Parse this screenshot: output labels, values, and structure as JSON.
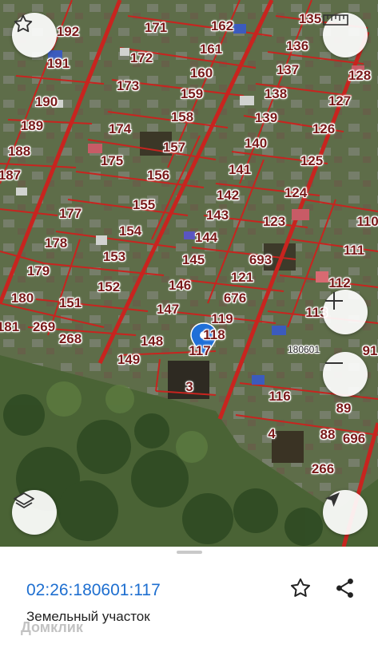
{
  "map": {
    "parcel_labels": [
      "135",
      "192",
      "171",
      "162",
      "136",
      "191",
      "172",
      "161",
      "137",
      "128",
      "173",
      "160",
      "190",
      "159",
      "138",
      "127",
      "189",
      "158",
      "139",
      "126",
      "174",
      "188",
      "157",
      "140",
      "175",
      "125",
      "156",
      "141",
      "124",
      "187",
      "177",
      "155",
      "142",
      "123",
      "110",
      "154",
      "143",
      "178",
      "144",
      "111",
      "153",
      "693",
      "145",
      "179",
      "121",
      "112",
      "152",
      "146",
      "676",
      "180",
      "151",
      "147",
      "119",
      "181",
      "269",
      "268",
      "148",
      "117",
      "149",
      "3",
      "116",
      "89",
      "4",
      "88",
      "696",
      "266",
      "118",
      "113",
      "91"
    ],
    "quarter_label": "180601",
    "selected_parcel": "117",
    "map_colors": {
      "boundary": "#c8241f",
      "vegetation": "#4f6a3a",
      "marker": "#1f6fd8"
    }
  },
  "controls": {
    "favorite": "star-icon",
    "ruler": "ruler-icon",
    "zoom_in": "+",
    "zoom_out": "−",
    "layers": "layers-icon",
    "locate": "location-arrow-icon"
  },
  "info": {
    "cadastral_number": "02:26:180601:117",
    "land_type": "Земельный участок",
    "watermark": "Домклик"
  }
}
